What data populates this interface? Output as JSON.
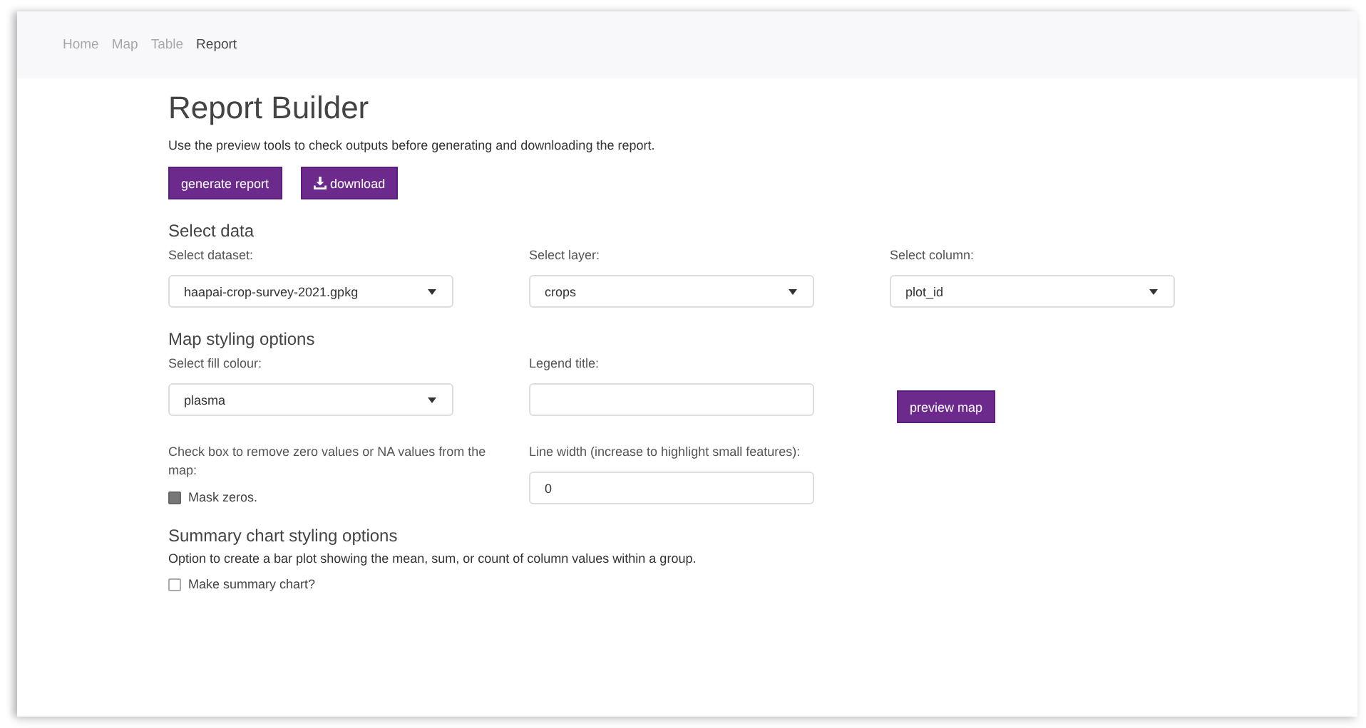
{
  "nav": [
    {
      "label": "Home",
      "selected": false
    },
    {
      "label": "Map",
      "selected": false
    },
    {
      "label": "Table",
      "selected": false
    },
    {
      "label": "Report",
      "selected": true
    }
  ],
  "title": "Report Builder",
  "intro": "Use the preview tools to check outputs before generating and downloading the report.",
  "buttons": [
    {
      "label": "generate report",
      "kind": "plain"
    },
    {
      "label": "download",
      "kind": "download"
    }
  ],
  "sections": [
    {
      "heading": "Select data",
      "fields": [
        {
          "kind": "select",
          "label": "Select dataset:",
          "value": "haapai-crop-survey-2021.gpkg"
        },
        {
          "kind": "select",
          "label": "Select layer:",
          "value": "crops"
        },
        {
          "kind": "select",
          "label": "Select column:",
          "value": "plot_id"
        }
      ]
    },
    {
      "heading": "Map styling options",
      "fields": [
        {
          "kind": "select",
          "label": "Select fill colour:",
          "value": "plasma"
        },
        {
          "kind": "text",
          "label": "Legend title:"
        },
        {
          "kind": "button",
          "label": "preview map"
        },
        {
          "kind": "checkbox",
          "label": "Check box to remove zero values or NA values from the map:",
          "option": "Mask zeros.",
          "checked": true
        },
        {
          "kind": "text",
          "label": "Line width (increase to highlight small features):",
          "value": "0"
        }
      ]
    },
    {
      "heading": "Summary chart styling options",
      "fields": [
        {
          "kind": "note",
          "label": "Option to create a bar plot showing the mean, sum, or count of column values within a group."
        },
        {
          "kind": "checkbox",
          "option": "Make summary chart?",
          "checked": false
        }
      ]
    }
  ]
}
